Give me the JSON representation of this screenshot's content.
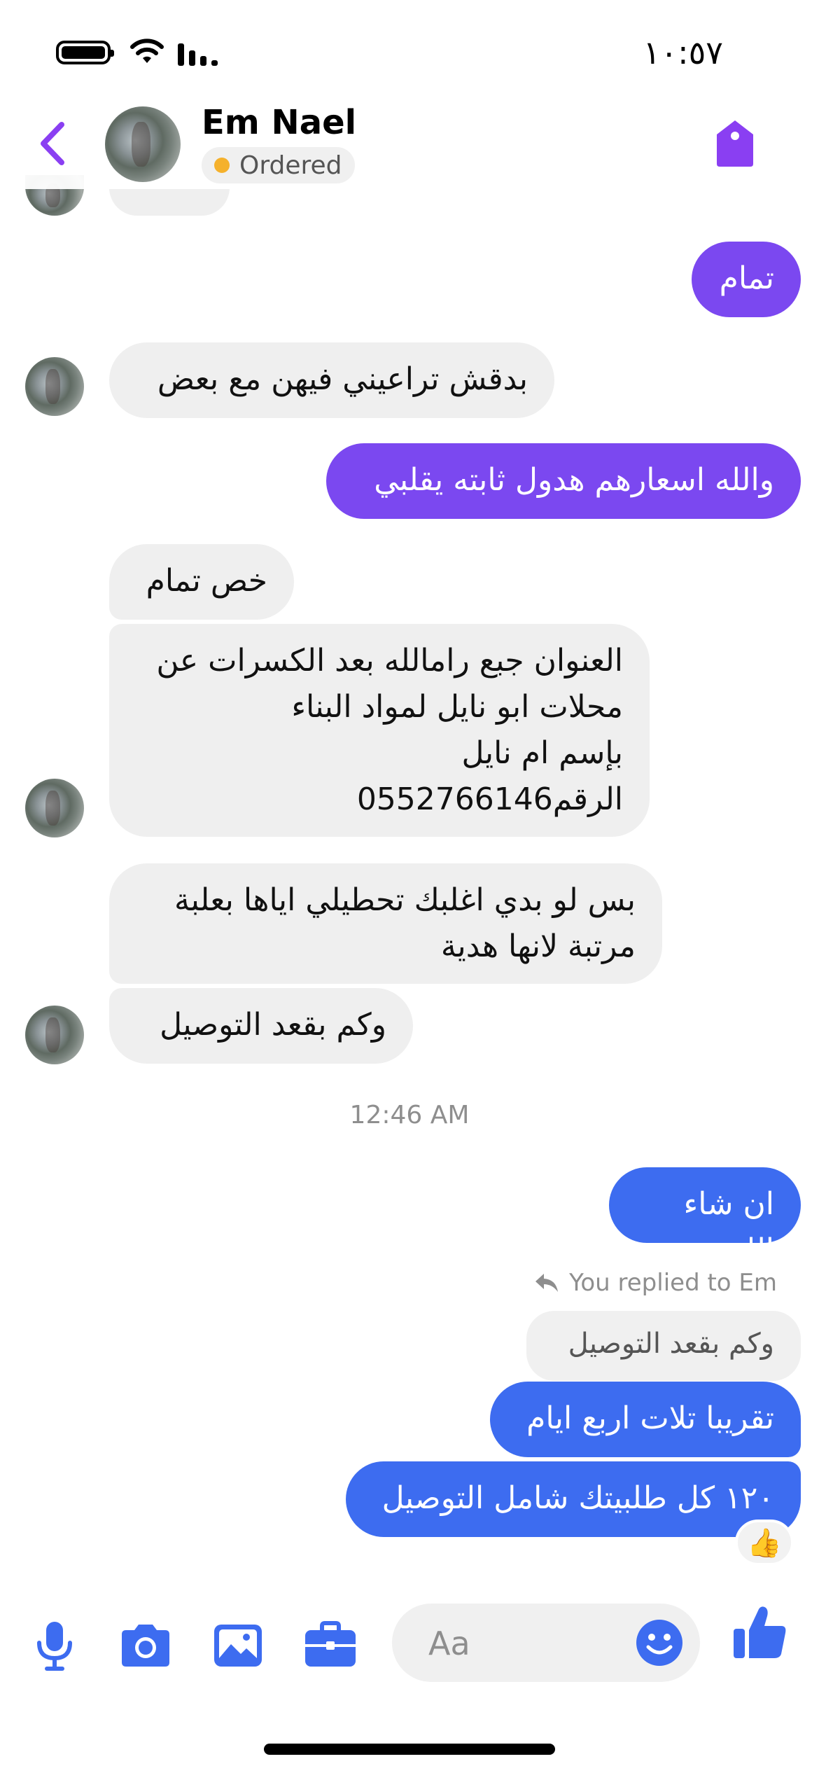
{
  "status_bar": {
    "time": "١٠:٥٧"
  },
  "header": {
    "contact_name": "Em Nael",
    "status": "Ordered"
  },
  "messages": [
    {
      "type": "sent",
      "text": "تمام"
    },
    {
      "type": "received",
      "text": "بدقش تراعيني فيهن مع بعض"
    },
    {
      "type": "sent",
      "text": "والله اسعارهم هدول ثابته يقلبي"
    },
    {
      "type": "received",
      "text": "خص تمام"
    },
    {
      "type": "received",
      "text": "العنوان جبع رامالله بعد الكسرات عن\nمحلات ابو نايل لمواد البناء\nبإسم ام نايل\nالرقم0552766146"
    },
    {
      "type": "received",
      "text": "بس لو بدي اغلبك تحطيلي اياها بعلبة\nمرتبة لانها هدية"
    },
    {
      "type": "received",
      "text": "وكم بقعد التوصيل"
    },
    {
      "type": "sent",
      "text": "ان شاء الله"
    },
    {
      "type": "sent",
      "text": "تقريبا تلات اربع ايام"
    },
    {
      "type": "sent",
      "text": "١٢٠ كل طلبيتك شامل التوصيل"
    }
  ],
  "timestamp_separator": "12:46 AM",
  "reply_note": "You replied to Em",
  "quoted_text": "وكم بقعد التوصيل",
  "reaction": "👍",
  "composer": {
    "placeholder": "Aa"
  },
  "colors": {
    "purple_bubble": "#7b48f0",
    "blue_bubble": "#3d6cf0",
    "received_bubble": "#efefef",
    "accent_icons": "#3d6cf0",
    "header_accent": "#8a3ff2",
    "status_dot": "#f5b12c"
  }
}
